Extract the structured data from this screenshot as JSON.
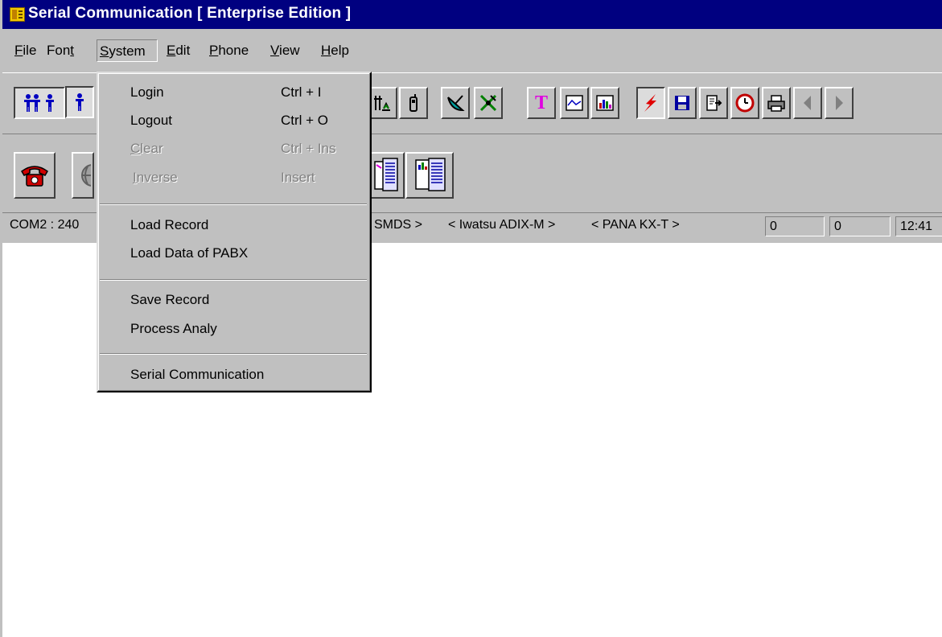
{
  "window": {
    "title": "Serial Communication [ Enterprise Edition ]",
    "icon": "app-icon"
  },
  "menubar": {
    "items": [
      {
        "label": "File",
        "access_key": "F"
      },
      {
        "label": "Font",
        "access_key": "t"
      },
      {
        "label": "System",
        "access_key": "S",
        "active": true
      },
      {
        "label": "Edit",
        "access_key": "E"
      },
      {
        "label": "Phone",
        "access_key": "P"
      },
      {
        "label": "View",
        "access_key": "V"
      },
      {
        "label": "Help",
        "access_key": "H"
      }
    ]
  },
  "system_menu": {
    "items": [
      {
        "label": "Login",
        "shortcut": "Ctrl + I",
        "enabled": true
      },
      {
        "label": "Logout",
        "shortcut": "Ctrl + O",
        "enabled": true
      },
      {
        "label": "Clear",
        "shortcut": "Ctrl + Ins",
        "enabled": false
      },
      {
        "label": "Inverse",
        "shortcut": "Insert",
        "enabled": false
      },
      {
        "label": "Load Record",
        "shortcut": "",
        "enabled": true
      },
      {
        "label": "Load Data of PABX",
        "shortcut": "",
        "enabled": true
      },
      {
        "label": "Save Record",
        "shortcut": "",
        "enabled": true
      },
      {
        "label": "Process Analy",
        "shortcut": "",
        "enabled": true
      },
      {
        "label": "Serial Communication",
        "shortcut": "",
        "enabled": true
      }
    ]
  },
  "toolbar1": {
    "buttons": [
      "users-icon",
      "user-icon",
      "network-graph-icon",
      "mobile-phone-icon",
      "satellite-dish-icon",
      "satellite-icon",
      "text-icon",
      "line-chart-icon",
      "bar-chart-icon",
      "lightning-icon",
      "save-icon",
      "export-icon",
      "clock-icon",
      "printer-icon",
      "arrow-left-icon",
      "arrow-right-icon"
    ],
    "colors": {
      "pressed_bg": "#dcdcdc",
      "text_icon": "#e000e0",
      "lightning": "#e00000"
    }
  },
  "toolbar2": {
    "buttons": [
      "telephone-icon",
      "globe-icon",
      "pabx-report-icon",
      "pabx-chart-icon"
    ],
    "colors": {
      "telephone": "#d00000"
    }
  },
  "statusbar": {
    "port": "COM2 : 240",
    "smds": "SMDS >",
    "iwatsu": "< Iwatsu ADIX-M >",
    "pana": "< PANA KX-T >",
    "field1": "0",
    "field2": "0",
    "time": "12:41"
  },
  "colors": {
    "titlebar": "#000080",
    "chrome": "#c0c0c0",
    "workspace": "#ffffff",
    "disabled_text": "#808080"
  }
}
